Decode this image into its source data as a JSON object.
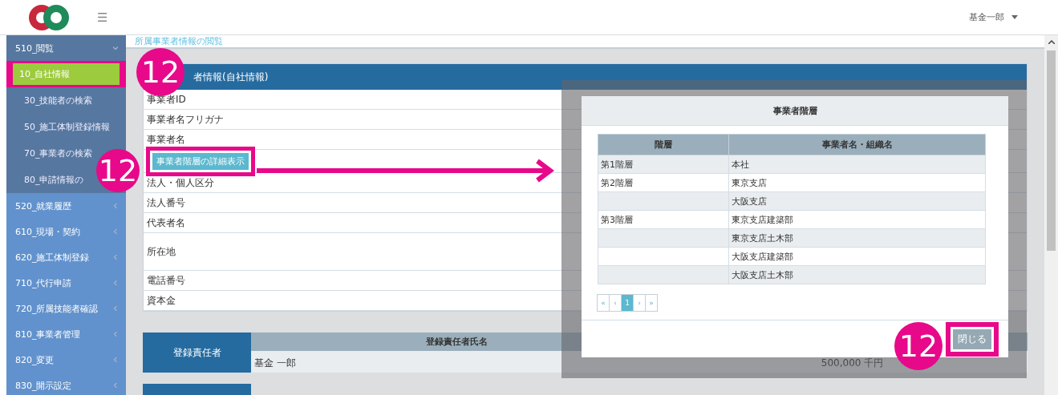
{
  "header": {
    "menu_icon": "☰",
    "user": "基金一郎"
  },
  "sidebar": {
    "groups": [
      {
        "label": "510_閲覧",
        "expanded": true,
        "children": [
          {
            "label": "10_自社情報",
            "selected": true
          },
          {
            "label": "30_技能者の検索",
            "selected": false
          },
          {
            "label": "50_施工体制登録情報",
            "selected": false
          },
          {
            "label": "70_事業者の検索",
            "selected": false
          },
          {
            "label": "80_申請情報の",
            "selected": false
          }
        ]
      },
      {
        "label": "520_就業履歴",
        "expanded": false
      },
      {
        "label": "610_現場・契約",
        "expanded": false
      },
      {
        "label": "620_施工体制登録",
        "expanded": false
      },
      {
        "label": "710_代行申請",
        "expanded": false
      },
      {
        "label": "720_所属技能者確認",
        "expanded": false
      },
      {
        "label": "810_事業者管理",
        "expanded": false
      },
      {
        "label": "820_変更",
        "expanded": false
      },
      {
        "label": "830_開示設定",
        "expanded": false
      }
    ]
  },
  "breadcrumb": "所属事業者情報の閲覧",
  "info_card": {
    "title": "者情報(自社情報)",
    "rows": [
      {
        "kind": "line",
        "label": "事業者ID"
      },
      {
        "kind": "line",
        "label": "事業者名フリガナ"
      },
      {
        "kind": "line",
        "label": "事業者名"
      },
      {
        "kind": "button",
        "label": "事業者階層の詳細表示"
      },
      {
        "kind": "line",
        "label": "法人・個人区分"
      },
      {
        "kind": "line",
        "label": "法人番号"
      },
      {
        "kind": "line",
        "label": "代表者名"
      },
      {
        "kind": "multiline",
        "label": "所在地"
      },
      {
        "kind": "line",
        "label": "電話番号"
      },
      {
        "kind": "line",
        "label": "資本金"
      }
    ]
  },
  "registrant": {
    "label": "登録責任者",
    "column": "登録責任者氏名",
    "name": "基金 一郎",
    "capital": "500,000 千円"
  },
  "modal": {
    "title": "事業者階層",
    "columns": [
      "階層",
      "事業者名・組織名"
    ],
    "rows": [
      [
        "第1階層",
        "本社"
      ],
      [
        "第2階層",
        "東京支店"
      ],
      [
        "",
        "大阪支店"
      ],
      [
        "第3階層",
        "東京支店建築部"
      ],
      [
        "",
        "東京支店土木部"
      ],
      [
        "",
        "大阪支店建築部"
      ],
      [
        "",
        "大阪支店土木部"
      ]
    ],
    "pagination": [
      {
        "label": "«",
        "selected": false
      },
      {
        "label": "‹",
        "selected": false
      },
      {
        "label": "1",
        "selected": true
      },
      {
        "label": "›",
        "selected": false
      },
      {
        "label": "»",
        "selected": false
      }
    ],
    "close_button": "閉じる"
  },
  "callouts": [
    "12",
    "12",
    "12"
  ]
}
